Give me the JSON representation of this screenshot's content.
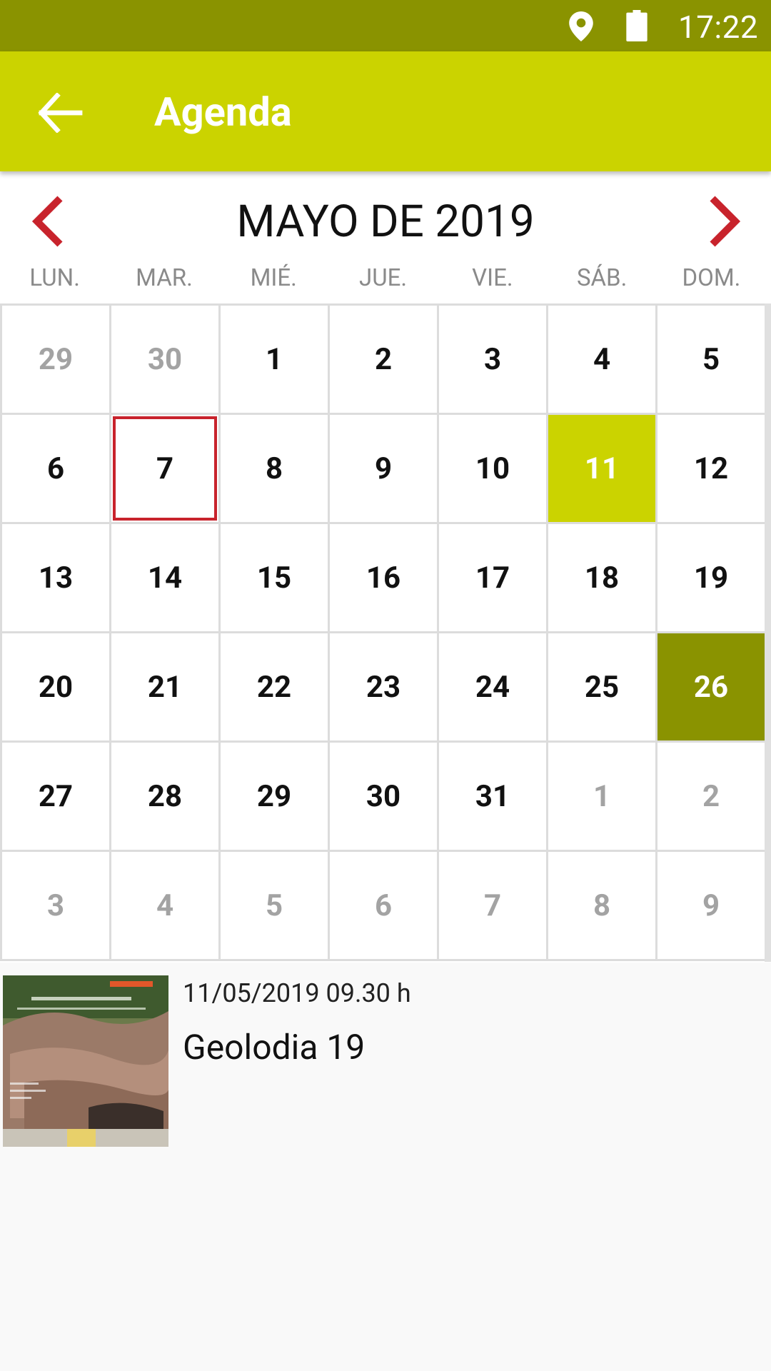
{
  "status_bar": {
    "time": "17:22",
    "icons": [
      "location-icon",
      "battery-icon"
    ]
  },
  "app_bar": {
    "title": "Agenda",
    "back_icon": "arrow-left-icon"
  },
  "calendar": {
    "month_title": "MAYO DE 2019",
    "weekdays": [
      "LUN.",
      "MAR.",
      "MIÉ.",
      "JUE.",
      "VIE.",
      "SÁB.",
      "DOM."
    ],
    "weeks": [
      [
        {
          "d": "29",
          "out": true
        },
        {
          "d": "30",
          "out": true
        },
        {
          "d": "1"
        },
        {
          "d": "2"
        },
        {
          "d": "3"
        },
        {
          "d": "4"
        },
        {
          "d": "5"
        }
      ],
      [
        {
          "d": "6"
        },
        {
          "d": "7",
          "selected": true
        },
        {
          "d": "8"
        },
        {
          "d": "9"
        },
        {
          "d": "10"
        },
        {
          "d": "11",
          "event": true
        },
        {
          "d": "12"
        }
      ],
      [
        {
          "d": "13"
        },
        {
          "d": "14"
        },
        {
          "d": "15"
        },
        {
          "d": "16"
        },
        {
          "d": "17"
        },
        {
          "d": "18"
        },
        {
          "d": "19"
        }
      ],
      [
        {
          "d": "20"
        },
        {
          "d": "21"
        },
        {
          "d": "22"
        },
        {
          "d": "23"
        },
        {
          "d": "24"
        },
        {
          "d": "25"
        },
        {
          "d": "26",
          "today": true
        }
      ],
      [
        {
          "d": "27"
        },
        {
          "d": "28"
        },
        {
          "d": "29"
        },
        {
          "d": "30"
        },
        {
          "d": "31"
        },
        {
          "d": "1",
          "out": true
        },
        {
          "d": "2",
          "out": true
        }
      ],
      [
        {
          "d": "3",
          "out": true
        },
        {
          "d": "4",
          "out": true
        },
        {
          "d": "5",
          "out": true
        },
        {
          "d": "6",
          "out": true
        },
        {
          "d": "7",
          "out": true
        },
        {
          "d": "8",
          "out": true
        },
        {
          "d": "9",
          "out": true
        }
      ]
    ]
  },
  "events": [
    {
      "date": "11/05/2019 09.30 h",
      "title": "Geolodia 19"
    }
  ],
  "colors": {
    "status_bar": "#8a9300",
    "app_bar": "#cbd300",
    "event_day": "#cbd300",
    "today": "#8a9300",
    "selected_border": "#c8232c",
    "nav_arrow": "#c8232c"
  }
}
